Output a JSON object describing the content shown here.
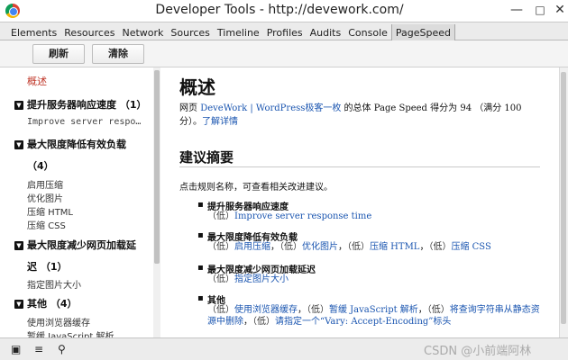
{
  "window": {
    "title": "Developer Tools - http://devework.com/",
    "app_icon": "chrome-icon",
    "controls": [
      "minimize",
      "maximize",
      "close"
    ]
  },
  "tabs": [
    {
      "label": "Elements",
      "active": false
    },
    {
      "label": "Resources",
      "active": false
    },
    {
      "label": "Network",
      "active": false
    },
    {
      "label": "Sources",
      "active": false
    },
    {
      "label": "Timeline",
      "active": false
    },
    {
      "label": "Profiles",
      "active": false
    },
    {
      "label": "Audits",
      "active": false
    },
    {
      "label": "Console",
      "active": false
    },
    {
      "label": "PageSpeed",
      "active": true
    }
  ],
  "toolbar": {
    "refresh_label": "刷新",
    "clear_label": "清除"
  },
  "sidebar": {
    "overview_label": "概述",
    "groups": [
      {
        "title": "提升服务器响应速度 （1）",
        "items": [
          "Improve server respo…"
        ]
      },
      {
        "title": "最大限度降低有效负载",
        "title_cont": "（4）",
        "items": [
          "启用压缩",
          "优化图片",
          "压缩 HTML",
          "压缩 CSS"
        ]
      },
      {
        "title": "最大限度减少网页加载延",
        "title_cont": "迟 （1）",
        "items": [
          "指定图片大小"
        ]
      },
      {
        "title": "其他 （4）",
        "items": [
          "使用浏览器缓存",
          "暂缓 JavaScript 解析"
        ]
      }
    ]
  },
  "main": {
    "heading": "概述",
    "summary": {
      "prefix": "网页 ",
      "site_link": "DeveWork | WordPress极客一枚",
      "middle": " 的总体 Page Speed 得分为 ",
      "score": "94",
      "suffix": " （满分 100 分）。",
      "details_link": "了解详情"
    },
    "suggestions_heading": "建议摘要",
    "intro": "点击规则名称，可查看相关改进建议。",
    "rules": [
      {
        "title": "提升服务器响应速度",
        "level": "（低）",
        "links": [
          "Improve server response time"
        ]
      },
      {
        "title": "最大限度降低有效负载",
        "level": "（低）",
        "links": [
          "启用压缩",
          "优化图片",
          "压缩 HTML",
          "压缩 CSS"
        ]
      },
      {
        "title": "最大限度减少网页加载延迟",
        "level": "（低）",
        "links": [
          "指定图片大小"
        ]
      },
      {
        "title": "其他",
        "level": "（低）",
        "links": [
          "使用浏览器缓存",
          "暂缓 JavaScript 解析",
          "将查询字符串从静态资源中删除",
          "请指定一个“Vary: Accept-Encoding”标头"
        ]
      }
    ]
  },
  "statusbar": {
    "icons": [
      "dock-icon",
      "console-drawer-icon",
      "search-icon"
    ],
    "watermark": "CSDN @小前端阿林"
  }
}
